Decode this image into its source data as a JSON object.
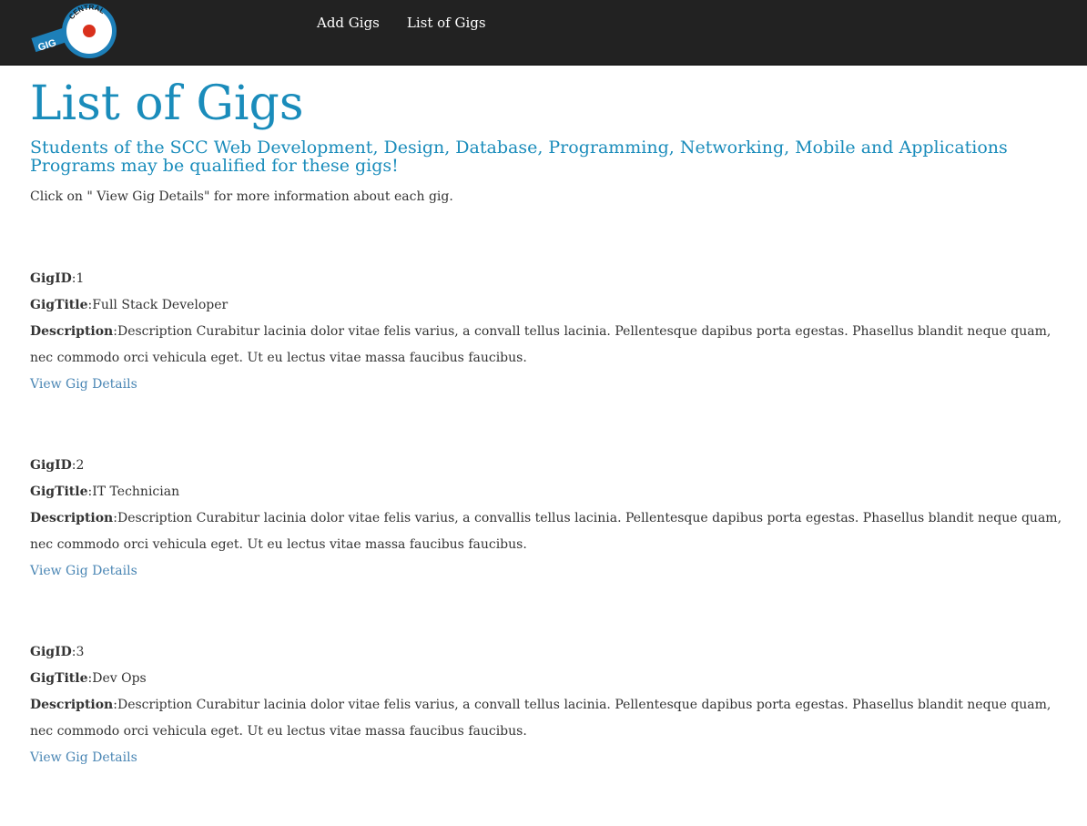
{
  "nav": {
    "logo_text_top": "CENTRAL",
    "logo_text_side": "GIG",
    "links": [
      {
        "label": "Add Gigs"
      },
      {
        "label": "List of Gigs"
      }
    ]
  },
  "main": {
    "title": "List of Gigs",
    "subtitle": "Students of the SCC Web Development, Design, Database, Programming, Networking, Mobile and Applications Programs may be qualified for these gigs!",
    "intro": "Click on \" View Gig Details\" for more information about each gig."
  },
  "labels": {
    "gig_id": "GigID",
    "gig_title": "GigTitle",
    "description": "Description",
    "view_details": "View Gig Details"
  },
  "gigs": [
    {
      "id": "1",
      "title": "Full Stack Developer",
      "description": "Description Curabitur lacinia dolor vitae felis varius, a convall tellus lacinia. Pellentesque dapibus porta egestas. Phasellus blandit neque quam, nec commodo orci vehicula eget. Ut eu lectus vitae massa faucibus faucibus."
    },
    {
      "id": "2",
      "title": "IT Technician",
      "description": "Description Curabitur lacinia dolor vitae felis varius, a convallis tellus lacinia. Pellentesque dapibus porta egestas. Phasellus blandit neque quam, nec commodo orci vehicula eget. Ut eu lectus vitae massa faucibus faucibus."
    },
    {
      "id": "3",
      "title": "Dev Ops",
      "description": "Description Curabitur lacinia dolor vitae felis varius, a convall tellus lacinia. Pellentesque dapibus porta egestas. Phasellus blandit neque quam, nec commodo orci vehicula eget. Ut eu lectus vitae massa faucibus faucibus."
    }
  ],
  "colors": {
    "navbar": "#222222",
    "heading": "#1a8cbb",
    "link": "#4a86b4",
    "logo_ring": "#1d7fb8",
    "logo_dot": "#d9301c"
  }
}
